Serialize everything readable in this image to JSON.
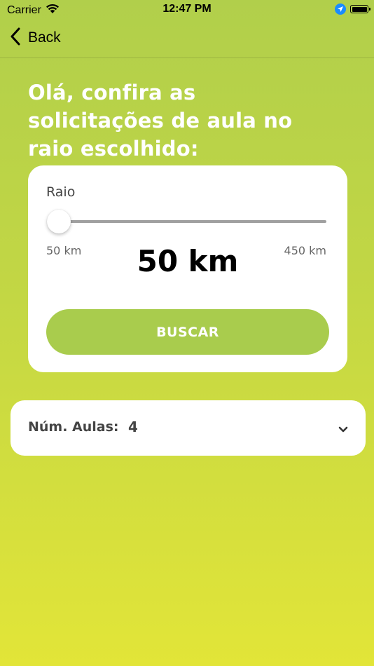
{
  "status_bar": {
    "carrier": "Carrier",
    "time": "12:47 PM",
    "icons": [
      "wifi-icon",
      "location-icon",
      "battery-icon"
    ]
  },
  "nav": {
    "back_label": "Back"
  },
  "heading": {
    "title": "Olá, confira as solicitações de aula no raio escolhido:"
  },
  "radius": {
    "label": "Raio",
    "min_label": "50 km",
    "max_label": "450 km",
    "value_label": "50 km",
    "slider_fraction": 0
  },
  "search": {
    "button_label": "BUSCAR"
  },
  "lessons": {
    "label": "Núm. Aulas:",
    "value": "4"
  },
  "colors": {
    "gradient_top": "#b1cf4b",
    "gradient_bottom": "#e2e538",
    "button": "#a9cc4d",
    "card": "#ffffff"
  }
}
